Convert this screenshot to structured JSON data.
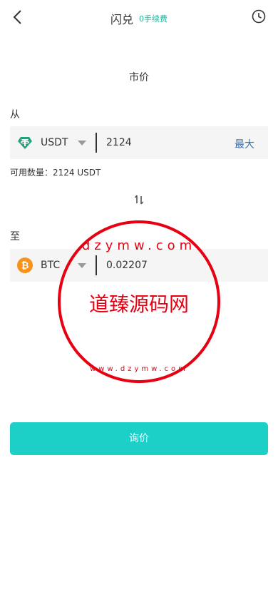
{
  "header": {
    "title": "闪兑",
    "fee_badge": "0手续费",
    "back_icon": "chevron-left-icon",
    "history_icon": "clock-icon"
  },
  "order_type": "市价",
  "from": {
    "label": "从",
    "coin": "USDT",
    "coin_icon": "tether-icon",
    "amount": "2124",
    "max_label": "最大",
    "available_text": "可用数量：2124 USDT"
  },
  "swap_icon": "swap-vertical-icon",
  "to": {
    "label": "至",
    "coin": "BTC",
    "coin_icon": "bitcoin-icon",
    "amount": "0.02207"
  },
  "action": {
    "label": "询价"
  },
  "watermark": {
    "text": "道臻源码网",
    "url_top": "dzymw.com",
    "url_bottom": "www.dzymw.com"
  },
  "colors": {
    "accent": "#1ccfc7",
    "fee_green": "#1fb59a",
    "max_blue": "#3a6fb0",
    "tether": "#26a17b",
    "bitcoin": "#f7931a",
    "stamp_red": "#e60012"
  }
}
